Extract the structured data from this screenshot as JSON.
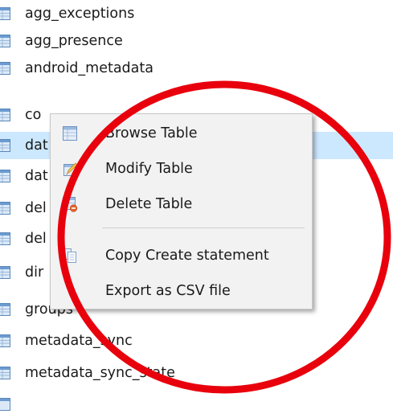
{
  "tables": [
    {
      "name": "agg_exceptions",
      "visible_label": "agg_exceptions",
      "selected": false
    },
    {
      "name": "agg_presence",
      "visible_label": "agg_presence",
      "selected": false
    },
    {
      "name": "android_metadata",
      "visible_label": "android_metadata",
      "selected": false
    },
    {
      "name": "co",
      "visible_label": "co",
      "selected": false
    },
    {
      "name": "dat",
      "visible_label": "dat",
      "selected": true
    },
    {
      "name": "dat",
      "visible_label": "dat",
      "selected": false
    },
    {
      "name": "del",
      "visible_label": "del",
      "selected": false
    },
    {
      "name": "del",
      "visible_label": "del",
      "selected": false
    },
    {
      "name": "dir",
      "visible_label": "dir",
      "selected": false
    },
    {
      "name": "groups",
      "visible_label": "groups",
      "selected": false
    },
    {
      "name": "metadata_sync",
      "visible_label": "metadata_sync",
      "selected": false
    },
    {
      "name": "metadata_sync_state",
      "visible_label": "metadata_sync_state",
      "selected": false
    }
  ],
  "context_menu": {
    "items": [
      {
        "label": "Browse Table",
        "icon": "browse-table-icon"
      },
      {
        "label": "Modify Table",
        "icon": "modify-table-icon"
      },
      {
        "label": "Delete Table",
        "icon": "delete-table-icon"
      },
      {
        "label": "Copy Create statement",
        "icon": "copy-icon"
      },
      {
        "label": "Export as CSV file",
        "icon": ""
      }
    ]
  },
  "colors": {
    "selection": "#cce8ff",
    "menu_background": "#f2f2f2",
    "annotation_circle": "#e8000c"
  }
}
